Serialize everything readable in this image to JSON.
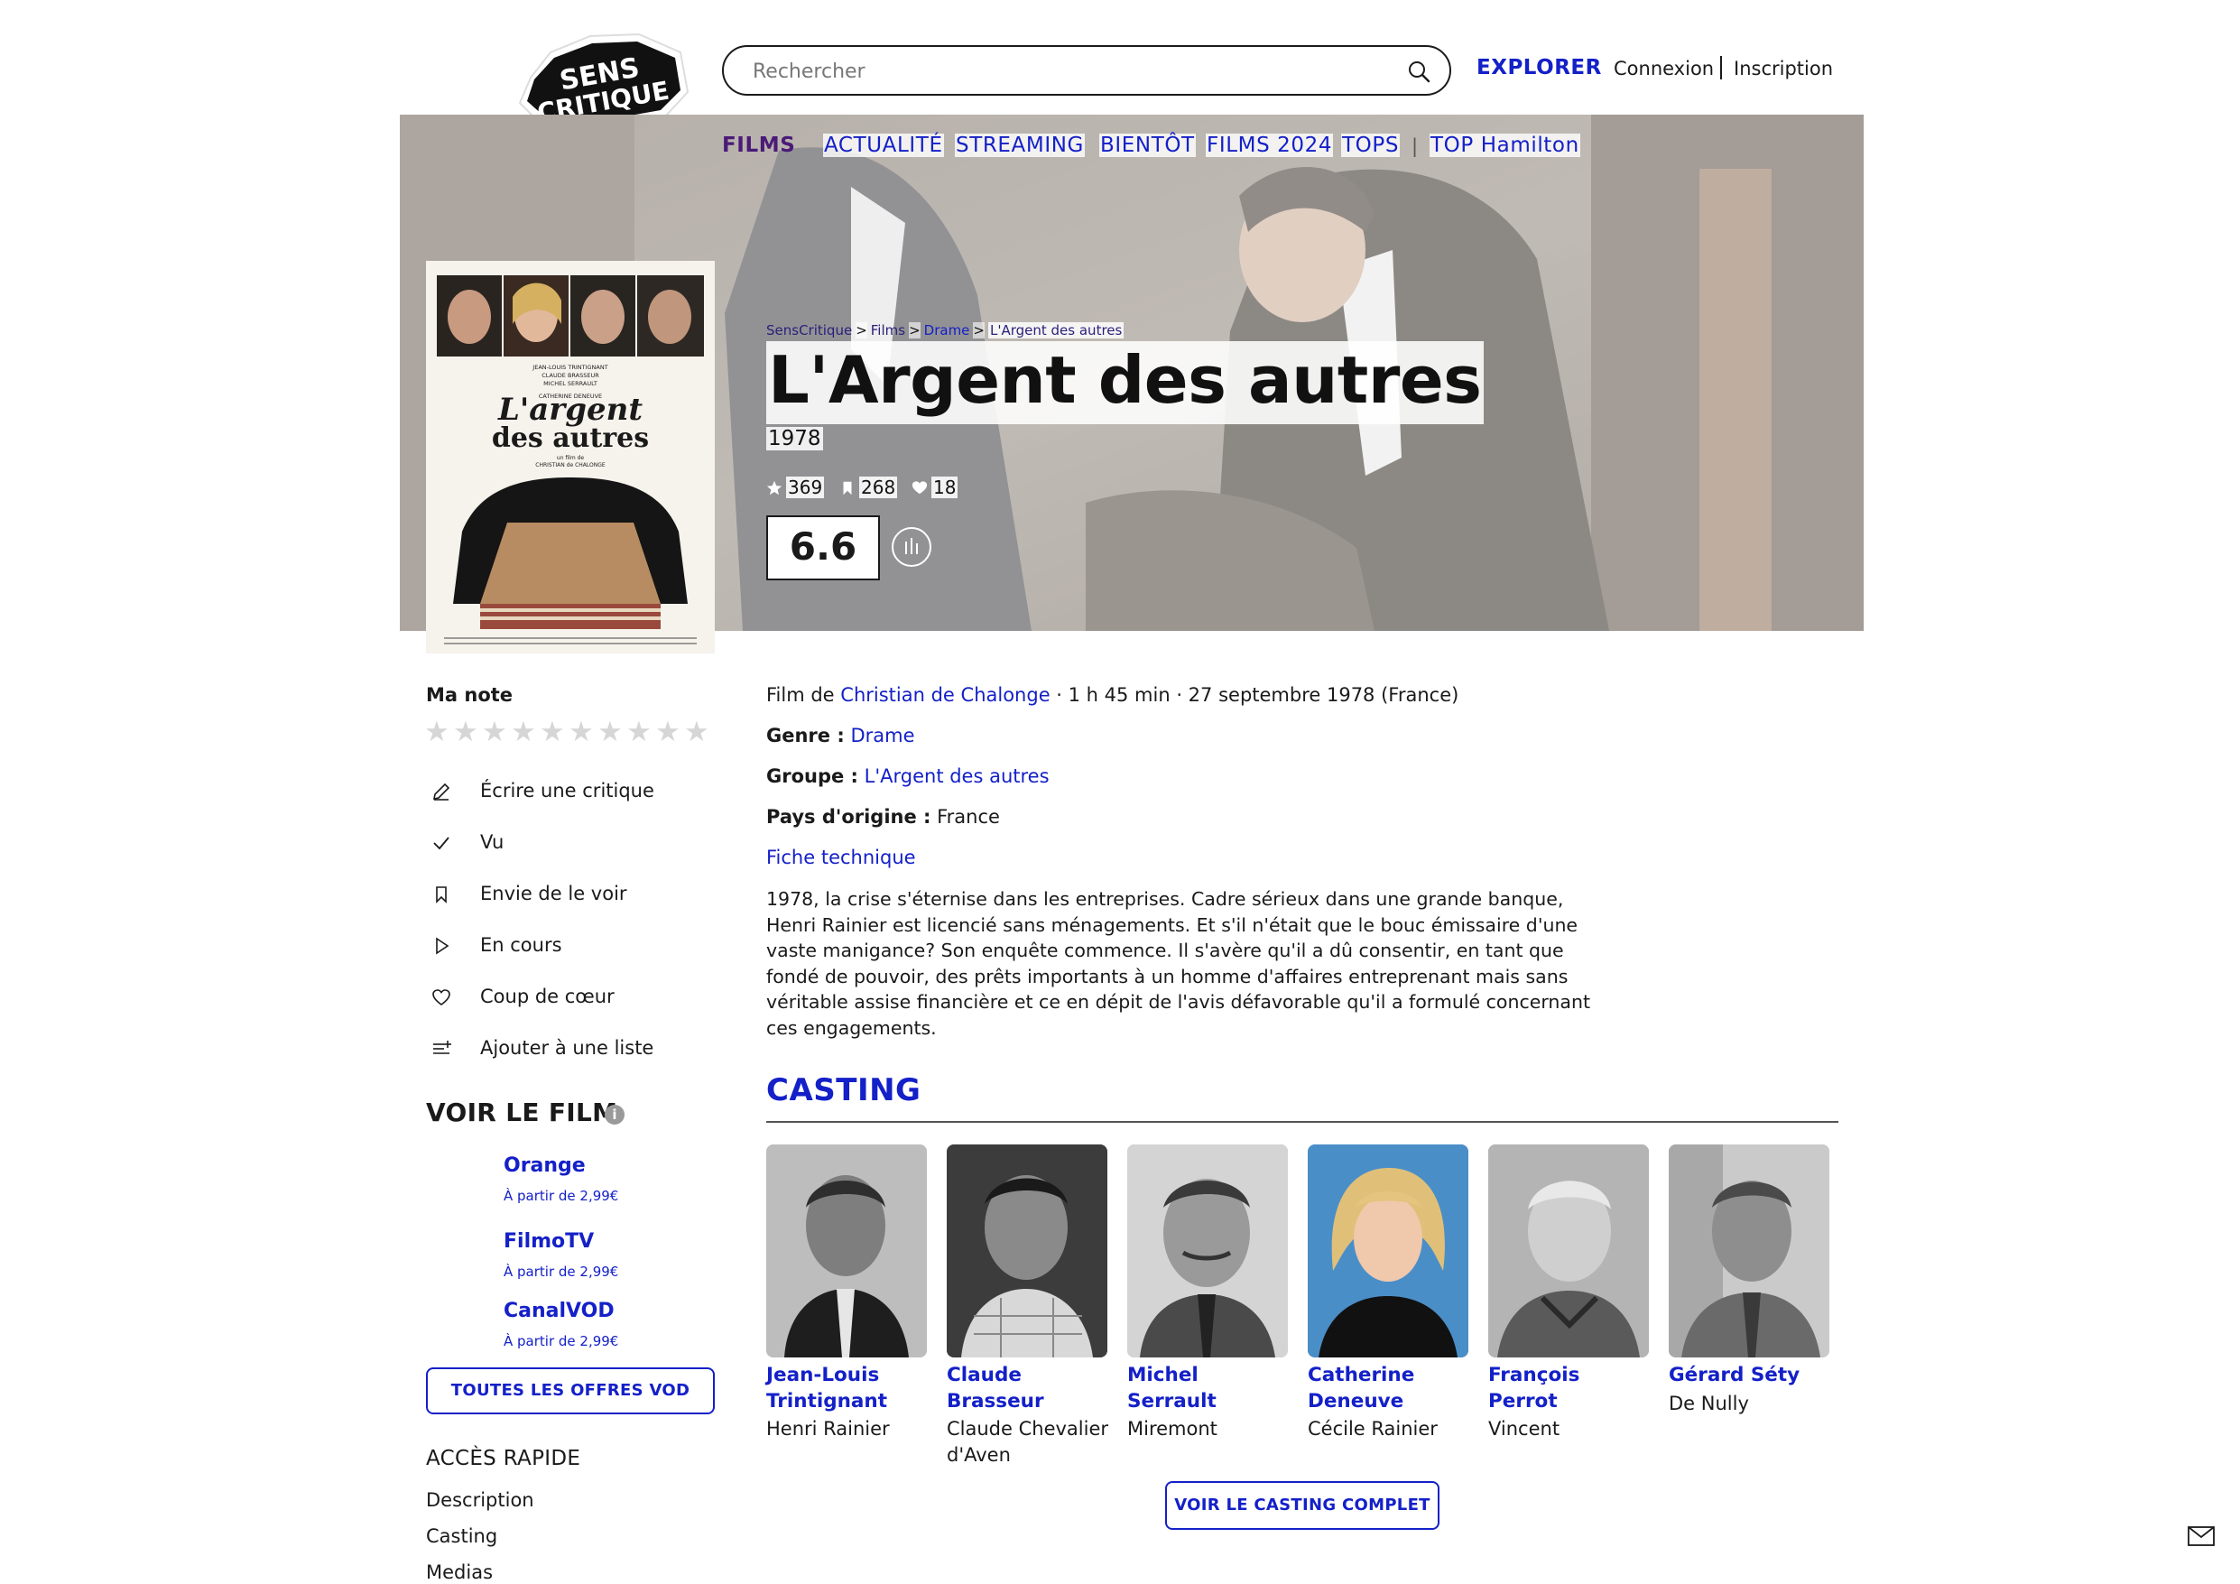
{
  "header": {
    "logo_top": "SENS",
    "logo_bottom": "CRITIQUE",
    "search_placeholder": "Rechercher",
    "explore": "EXPLORER",
    "login": "Connexion",
    "signup": "Inscription"
  },
  "nav": {
    "films": "FILMS",
    "items": [
      "ACTUALITÉ",
      "STREAMING",
      "BIENTÔT",
      "FILMS 2024",
      "TOPS",
      "TOP Hamilton"
    ],
    "separator": "|"
  },
  "breadcrumb": [
    "SensCritique",
    "Films",
    "Drame",
    "L'Argent des autres"
  ],
  "breadcrumb_separator": ">",
  "movie": {
    "title": "L'Argent des autres",
    "year": "1978",
    "stats": {
      "ratings": "369",
      "wishlist": "268",
      "favorites": "18"
    },
    "rating": "6.6",
    "poster": {
      "credits": [
        "JEAN-LOUIS TRINTIGNANT",
        "CLAUDE BRASSEUR",
        "MICHEL SERRAULT",
        "CATHERINE DENEUVE"
      ],
      "title_line1": "L'argent",
      "title_line2": "des autres",
      "byline1": "un film de",
      "byline2": "CHRISTIAN de CHALONGE"
    }
  },
  "my_rating": {
    "label": "Ma note",
    "star_count": 10
  },
  "actions": [
    {
      "icon": "pencil-icon",
      "label": "Écrire une critique"
    },
    {
      "icon": "check-icon",
      "label": "Vu"
    },
    {
      "icon": "bookmark-icon",
      "label": "Envie de le voir"
    },
    {
      "icon": "play-icon",
      "label": "En cours"
    },
    {
      "icon": "heart-icon",
      "label": "Coup de cœur"
    },
    {
      "icon": "add-list-icon",
      "label": "Ajouter à une liste"
    }
  ],
  "vod": {
    "title": "VOIR LE FILM",
    "info_icon": "i",
    "offers": [
      {
        "name": "Orange",
        "price": "À partir de 2,99€"
      },
      {
        "name": "FilmoTV",
        "price": "À partir de 2,99€"
      },
      {
        "name": "CanalVOD",
        "price": "À partir de 2,99€"
      }
    ],
    "all_offers": "TOUTES LES OFFRES VOD"
  },
  "quick_access": {
    "title": "ACCÈS RAPIDE",
    "links": [
      "Description",
      "Casting",
      "Medias"
    ]
  },
  "info": {
    "film_by_prefix": "Film de",
    "director": "Christian de Chalonge",
    "details": " · 1 h 45 min · 27 septembre 1978 (France)",
    "genre_label": "Genre :",
    "genre": "Drame",
    "group_label": "Groupe :",
    "group": "L'Argent des autres",
    "country_label": "Pays d'origine :",
    "country": "France",
    "tech_sheet": "Fiche technique",
    "synopsis": "1978, la crise s'éternise dans les entreprises. Cadre sérieux dans une grande banque, Henri Rainier est licencié sans ménagements. Et s'il n'était que le bouc émissaire d'une vaste manigance? Son enquête commence. Il s'avère qu'il a dû consentir, en tant que fondé de pouvoir, des prêts importants à un homme d'affaires entreprenant mais sans véritable assise financière et ce en dépit de l'avis défavorable qu'il a formulé concernant ces engagements."
  },
  "casting": {
    "title": "CASTING",
    "members": [
      {
        "name": "Jean-Louis Trintignant",
        "role": "Henri Rainier"
      },
      {
        "name": "Claude Brasseur",
        "role": "Claude Chevalier d'Aven"
      },
      {
        "name": "Michel Serrault",
        "role": "Miremont"
      },
      {
        "name": "Catherine Deneuve",
        "role": "Cécile Rainier"
      },
      {
        "name": "François Perrot",
        "role": "Vincent"
      },
      {
        "name": "Gérard Séty",
        "role": "De Nully"
      }
    ],
    "see_all": "VOIR LE CASTING COMPLET"
  },
  "colors": {
    "accent": "#1420c8",
    "films_nav": "#4a1a78",
    "text": "#1a1a1a",
    "star_empty": "#d6d6d6"
  }
}
